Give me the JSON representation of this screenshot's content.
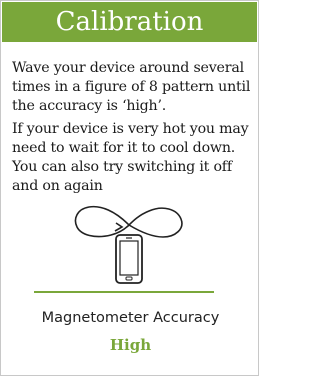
{
  "header": {
    "title": "Calibration"
  },
  "instructions": {
    "paragraph_1": "Wave your device around several times in a figure of 8 pattern until the accuracy is ‘high’.",
    "paragraph_2": "If your device is very hot you may need to wait for it to cool down. You can also try switching it off and on again"
  },
  "accuracy": {
    "label": "Magnetometer Accuracy",
    "value": "High"
  },
  "colors": {
    "accent": "#7aa73a",
    "text": "#1a1a1a"
  },
  "icons": {
    "illustration": "figure-eight-phone-icon"
  }
}
